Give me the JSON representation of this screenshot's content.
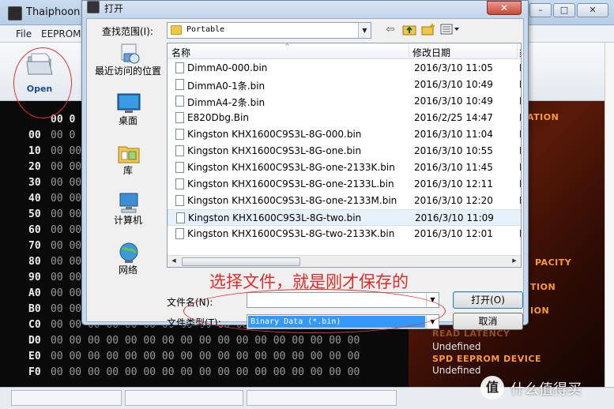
{
  "background_app": {
    "title": "Thaiphoon",
    "window_buttons": [
      "–",
      "□",
      "✕"
    ],
    "menu": [
      "File",
      "EEPROM"
    ],
    "toolbar": {
      "open_label": "Open"
    },
    "hex_header": "00 0",
    "hex_rows": [
      {
        "addr": "00",
        "cells": "00 0"
      },
      {
        "addr": "10",
        "cells": "00 00 00 00 00 00 00 00 00 00 00 00 00 00 00 00 00"
      },
      {
        "addr": "20",
        "cells": "00 00 00 00 00 00 00 00 00 00 00 00 00 00 00 00 00"
      },
      {
        "addr": "30",
        "cells": "00 00 00 00 00 00 00 00 00 00 00 00 00 00 00 00 00"
      },
      {
        "addr": "40",
        "cells": "00 00 00 00 00 00 00 00 00 00 00 00 00 00 00 00 00"
      },
      {
        "addr": "50",
        "cells": "00 00 00 00 00 00 00 00 00 00 00 00 00 00 00 00 00"
      },
      {
        "addr": "60",
        "cells": "00 00 00 00 00 00 00 00 00 00 00 00 00 00 00 00 00"
      },
      {
        "addr": "70",
        "cells": "00 00 00 00 00 00 00 00 00 00 00 00 00 00 00 00 00"
      },
      {
        "addr": "80",
        "cells": "00 00 00 00 00 00 00 00 00 00 00 00 00 00 00 00 00"
      },
      {
        "addr": "90",
        "cells": "00 00 00 00 00 00 00 00 00 00 00 00 00 00 00 00 00"
      },
      {
        "addr": "A0",
        "cells": "00 00 00 00 00 00 00 00 00 00 00 00 00 00 00 00 00"
      },
      {
        "addr": "B0",
        "cells": "00 00 00 00 00 00 00 00 00 00 00 00 00 00 00 00 00"
      },
      {
        "addr": "C0",
        "cells": "00 00 00 00 00 00 00 00 00 00 00 00 00 00 00 00 00"
      },
      {
        "addr": "D0",
        "cells": "00 00 00 00 00 00 00 00 00 00 00 00 00 00 00 00 00"
      },
      {
        "addr": "E0",
        "cells": "00 00 00 00 00 00 00 00 00 00 00 00 00 00 00 00 00"
      },
      {
        "addr": "F0",
        "cells": "00 00 00 00 00 00 00 00 00 00 00 00 00 00 00 00 00"
      }
    ],
    "right_panel": {
      "partial_heads": [
        "ATION",
        "PACITY",
        "TION",
        "ION",
        "READ LATENCY"
      ],
      "values": [
        "Undefined",
        "Undefined"
      ],
      "spd_head": "SPD EEPROM DEVICE"
    },
    "watermark": {
      "badge": "值",
      "text": "什么值得买"
    }
  },
  "dialog": {
    "title": "打开",
    "close": "✕",
    "look_in_label": "查找范围(I):",
    "look_in_value": "Portable",
    "places": [
      {
        "label": "最近访问的位置"
      },
      {
        "label": "桌面"
      },
      {
        "label": "库"
      },
      {
        "label": "计算机"
      },
      {
        "label": "网络"
      }
    ],
    "columns": {
      "name": "名称",
      "date": "修改日期",
      "extra": "类"
    },
    "files": [
      {
        "name": "DimmA0-000.bin",
        "date": "2016/3/10 11:05",
        "cut": "I"
      },
      {
        "name": "DimmA0-1条.bin",
        "date": "2016/3/10 10:49",
        "cut": "I"
      },
      {
        "name": "DimmA4-2条.bin",
        "date": "2016/3/10 10:49",
        "cut": "I"
      },
      {
        "name": "E820Dbg.Bin",
        "date": "2016/2/25 14:47",
        "cut": "I"
      },
      {
        "name": "Kingston KHX1600C9S3L-8G-000.bin",
        "date": "2016/3/10 11:04",
        "cut": "I"
      },
      {
        "name": "Kingston KHX1600C9S3L-8G-one.bin",
        "date": "2016/3/10 10:55",
        "cut": "I"
      },
      {
        "name": "Kingston KHX1600C9S3L-8G-one-2133K.bin",
        "date": "2016/3/10 11:45",
        "cut": "I"
      },
      {
        "name": "Kingston KHX1600C9S3L-8G-one-2133L.bin",
        "date": "2016/3/10 12:11",
        "cut": "I"
      },
      {
        "name": "Kingston KHX1600C9S3L-8G-one-2133M.bin",
        "date": "2016/3/10 12:20",
        "cut": "I"
      },
      {
        "name": "Kingston KHX1600C9S3L-8G-two.bin",
        "date": "2016/3/10 11:09",
        "cut": "I"
      },
      {
        "name": "Kingston KHX1600C9S3L-8G-two-2133K.bin",
        "date": "2016/3/10 12:01",
        "cut": "I"
      }
    ],
    "selected_index": 9,
    "annotation": "选择文件，就是刚才保存的",
    "file_name_label": "文件名(N):",
    "file_name_value": "",
    "file_type_label": "文件类型(T):",
    "file_type_value": "Binary Data (*.bin)",
    "open_button": "打开(O)",
    "cancel_button": "取消"
  },
  "colors": {
    "annotation": "#e02b2b",
    "accent_orange": "#ff9a3a",
    "selection": "#3399ff"
  }
}
